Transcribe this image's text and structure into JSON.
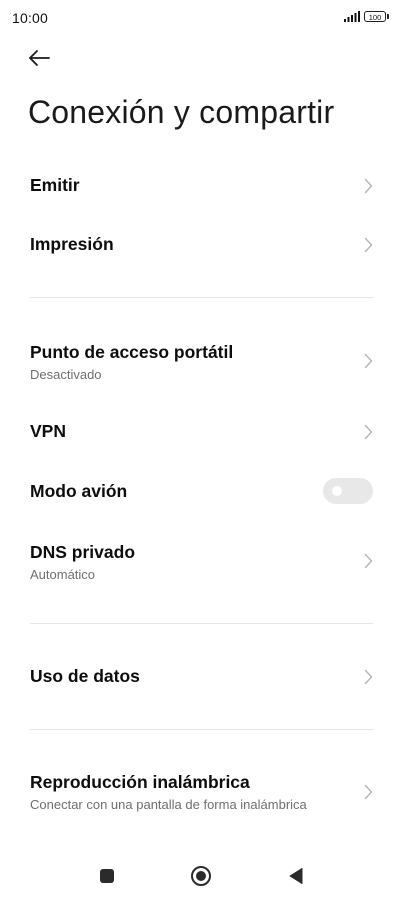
{
  "status_bar": {
    "time": "10:00",
    "battery": "100",
    "icons": [
      "signal-icon",
      "battery-icon"
    ]
  },
  "header": {
    "back_icon": "arrow-left-icon",
    "title": "Conexión y compartir"
  },
  "items": [
    {
      "id": "emitir",
      "title": "Emitir",
      "subtitle": "",
      "control": "chevron"
    },
    {
      "id": "impresion",
      "title": "Impresión",
      "subtitle": "",
      "control": "chevron"
    },
    {
      "id": "hotspot",
      "title": "Punto de acceso portátil",
      "subtitle": "Desactivado",
      "control": "chevron"
    },
    {
      "id": "vpn",
      "title": "VPN",
      "subtitle": "",
      "control": "chevron"
    },
    {
      "id": "airplane",
      "title": "Modo avión",
      "subtitle": "",
      "control": "toggle",
      "toggle_on": false
    },
    {
      "id": "dns",
      "title": "DNS privado",
      "subtitle": "Automático",
      "control": "chevron"
    },
    {
      "id": "data_usage",
      "title": "Uso de datos",
      "subtitle": "",
      "control": "chevron"
    },
    {
      "id": "wireless_display",
      "title": "Reproducción inalámbrica",
      "subtitle": "Conectar con una pantalla de forma inalámbrica",
      "control": "chevron"
    }
  ],
  "nav_bar": {
    "icons": [
      "recents-square-icon",
      "home-circle-icon",
      "back-triangle-icon"
    ]
  },
  "colors": {
    "background": "#ffffff",
    "text_primary": "#0d0d0d",
    "text_secondary": "#6f6f6f",
    "chevron": "#b5b5b5",
    "divider": "#e6e6e6",
    "toggle_off": "#e8e8e8"
  }
}
